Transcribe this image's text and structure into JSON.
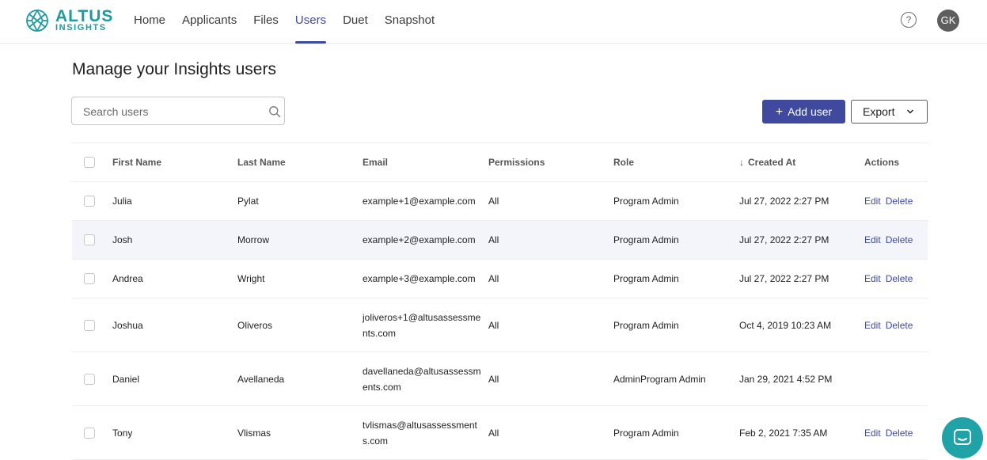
{
  "brand": {
    "name": "ALTUS",
    "sub": "INSIGHTS",
    "color": "#1f9a9e"
  },
  "nav": {
    "items": [
      {
        "label": "Home",
        "active": false
      },
      {
        "label": "Applicants",
        "active": false
      },
      {
        "label": "Files",
        "active": false
      },
      {
        "label": "Users",
        "active": true
      },
      {
        "label": "Duet",
        "active": false
      },
      {
        "label": "Snapshot",
        "active": false
      }
    ],
    "help_icon": "question-circle-icon",
    "avatar_initials": "GK"
  },
  "page": {
    "title": "Manage your Insights users",
    "search_placeholder": "Search users",
    "add_user_label": "Add user",
    "export_label": "Export"
  },
  "colors": {
    "accent": "#3f4a9e",
    "row_highlight": "#f3f5fa",
    "chat": "#1fa3a7"
  },
  "table": {
    "columns": [
      "First Name",
      "Last Name",
      "Email",
      "Permissions",
      "Role",
      "Created At",
      "Actions"
    ],
    "sort_indicator": "↓",
    "rows": [
      {
        "first": "Julia",
        "last": "Pylat",
        "email": "example+1@example.com",
        "permissions": "All",
        "role": "Program Admin",
        "created": "Jul 27, 2022 2:27 PM",
        "edit": "Edit",
        "delete": "Delete"
      },
      {
        "first": "Josh",
        "last": "Morrow",
        "email": "example+2@example.com",
        "permissions": "All",
        "role": "Program Admin",
        "created": "Jul 27, 2022 2:27 PM",
        "edit": "Edit",
        "delete": "Delete"
      },
      {
        "first": "Andrea",
        "last": "Wright",
        "email": "example+3@example.com",
        "permissions": "All",
        "role": "Program Admin",
        "created": "Jul 27, 2022 2:27 PM",
        "edit": "Edit",
        "delete": "Delete"
      },
      {
        "first": "Joshua",
        "last": "Oliveros",
        "email": "joliveros+1@altusassessments.com",
        "permissions": "All",
        "role": "Program Admin",
        "created": "Oct 4, 2019 10:23 AM",
        "edit": "Edit",
        "delete": "Delete"
      },
      {
        "first": "Daniel",
        "last": "Avellaneda",
        "email": "davellaneda@altusassessments.com",
        "permissions": "All",
        "role": "AdminProgram Admin",
        "created": "Jan 29, 2021 4:52 PM",
        "edit": "",
        "delete": ""
      },
      {
        "first": "Tony",
        "last": "Vlismas",
        "email": "tvlismas@altusassessments.com",
        "permissions": "All",
        "role": "Program Admin",
        "created": "Feb 2, 2021 7:35 AM",
        "edit": "Edit",
        "delete": "Delete"
      }
    ]
  },
  "chat_icon": "chat-bubble-icon"
}
